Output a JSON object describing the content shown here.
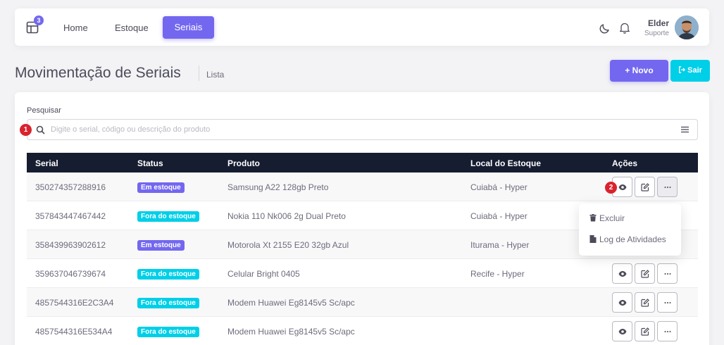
{
  "nav": {
    "badge_count": "3",
    "home": "Home",
    "estoque": "Estoque",
    "seriais": "Seriais",
    "user_name": "Elder",
    "user_role": "Suporte"
  },
  "page": {
    "title": "Movimentação de Seriais",
    "breadcrumb": "Lista",
    "novo_label": "+ Novo",
    "sair_label": "Sair"
  },
  "search": {
    "label": "Pesquisar",
    "placeholder": "Digite o serial, código ou descrição do produto",
    "value": ""
  },
  "markers": {
    "m1": "1",
    "m2": "2"
  },
  "table": {
    "headers": [
      "Serial",
      "Status",
      "Produto",
      "Local do Estoque",
      "Ações"
    ],
    "rows": [
      {
        "serial": "350274357288916",
        "status": "Em estoque",
        "produto": "Samsung A22 128gb Preto",
        "local": "Cuiabá - Hyper"
      },
      {
        "serial": "357843447467442",
        "status": "Fora do estoque",
        "produto": "Nokia 110 Nk006 2g Dual Preto",
        "local": "Cuiabá - Hyper"
      },
      {
        "serial": "358439963902612",
        "status": "Em estoque",
        "produto": "Motorola Xt 2155 E20 32gb Azul",
        "local": "Iturama - Hyper"
      },
      {
        "serial": "359637046739674",
        "status": "Fora do estoque",
        "produto": "Celular Bright 0405",
        "local": "Recife - Hyper"
      },
      {
        "serial": "4857544316E2C3A4",
        "status": "Fora do estoque",
        "produto": "Modem Huawei Eg8145v5 Sc/apc",
        "local": ""
      },
      {
        "serial": "4857544316E534A4",
        "status": "Fora do estoque",
        "produto": "Modem Huawei Eg8145v5 Sc/apc",
        "local": ""
      }
    ]
  },
  "dropdown": {
    "excluir": "Excluir",
    "log": "Log de Atividades"
  },
  "colors": {
    "primary": "#7367f0",
    "info": "#00cfe8",
    "dark_header": "#161d31",
    "marker": "#d9232f"
  }
}
